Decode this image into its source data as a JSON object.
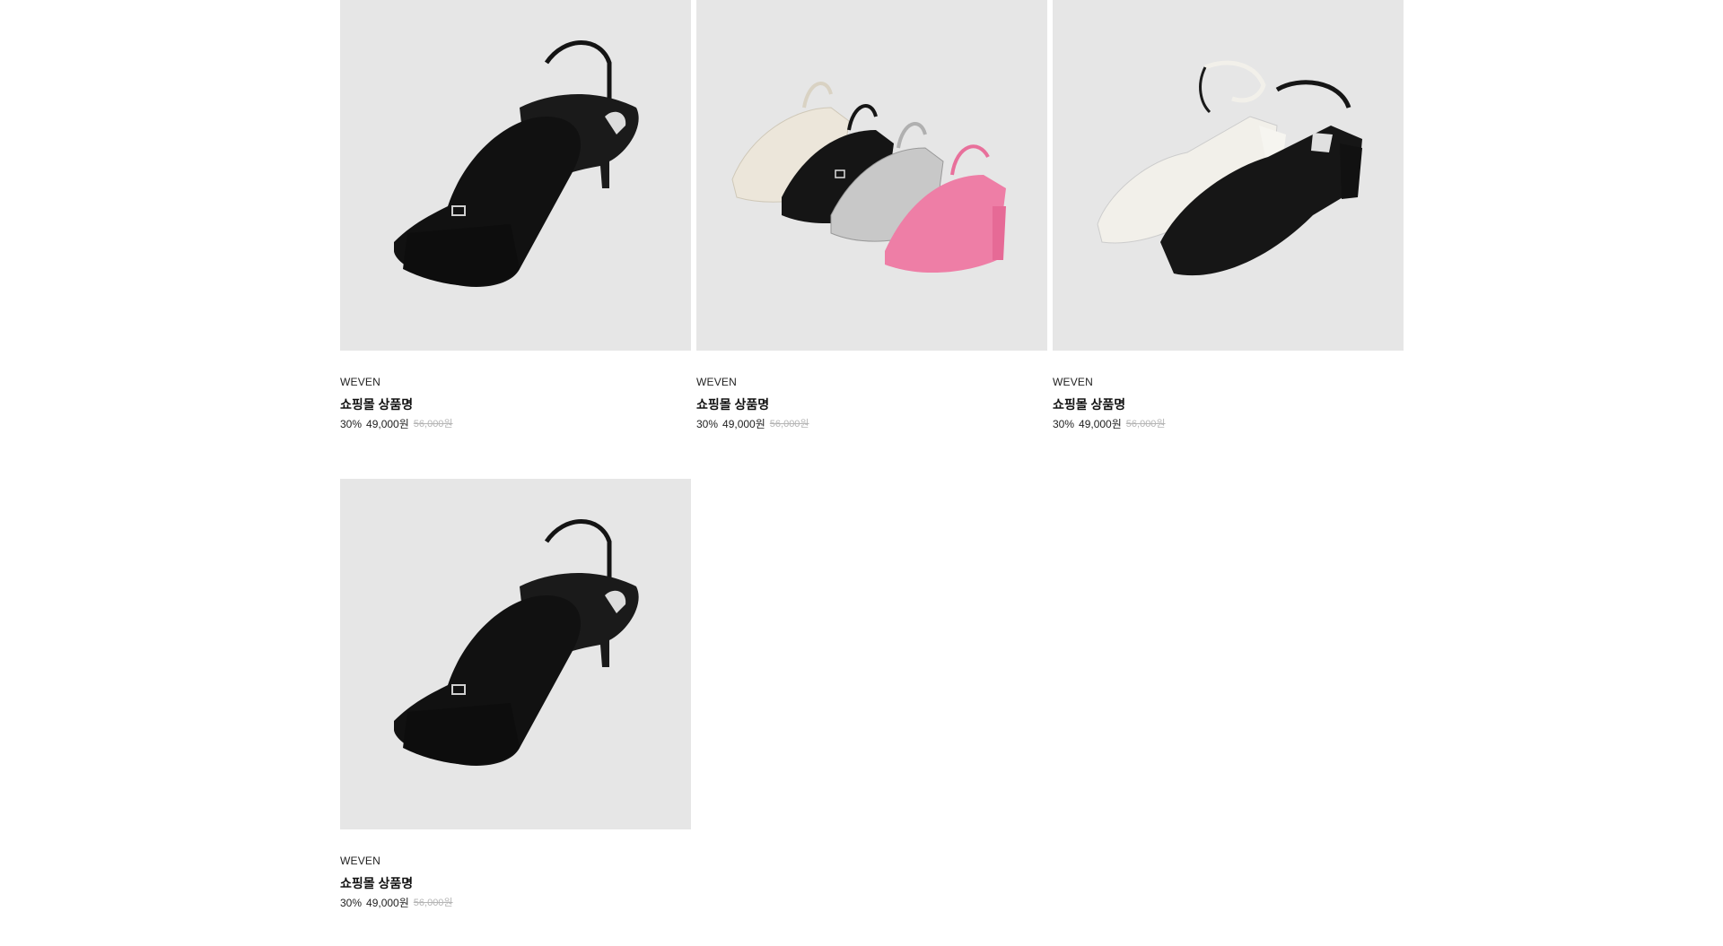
{
  "products": [
    {
      "brand": "WEVEN",
      "name": "쇼핑몰 상품명",
      "discount": "30%",
      "price": "49,000원",
      "original_price": "56,000원",
      "image": "black-slingback-sandal",
      "colors": [
        "#141414"
      ]
    },
    {
      "brand": "WEVEN",
      "name": "쇼핑몰 상품명",
      "discount": "30%",
      "price": "49,000원",
      "original_price": "56,000원",
      "image": "multi-color-strap-sandals",
      "colors": [
        "#ece6da",
        "#151515",
        "#c8c8c8",
        "#ee7ea6"
      ]
    },
    {
      "brand": "WEVEN",
      "name": "쇼핑몰 상품명",
      "discount": "30%",
      "price": "49,000원",
      "original_price": "56,000원",
      "image": "white-black-strappy-sandals",
      "colors": [
        "#f2f0ea",
        "#161616"
      ]
    },
    {
      "brand": "WEVEN",
      "name": "쇼핑몰 상품명",
      "discount": "30%",
      "price": "49,000원",
      "original_price": "56,000원",
      "image": "black-slingback-sandal",
      "colors": [
        "#141414"
      ]
    }
  ]
}
